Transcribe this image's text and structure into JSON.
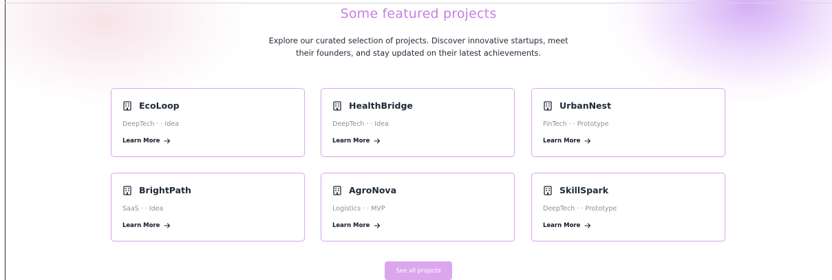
{
  "section": {
    "title": "Some featured projects",
    "intro_line1": "Explore our curated selection of projects. Discover innovative startups, meet",
    "intro_line2": "their founders, and stay updated on their latest achievements."
  },
  "projects": [
    {
      "name": "EcoLoop",
      "meta": "DeepTech · · Idea",
      "cta": "Learn More"
    },
    {
      "name": "HealthBridge",
      "meta": "DeepTech · · Idea",
      "cta": "Learn More"
    },
    {
      "name": "UrbanNest",
      "meta": "FinTech · · Prototype",
      "cta": "Learn More"
    },
    {
      "name": "BrightPath",
      "meta": "SaaS · · Idea",
      "cta": "Learn More"
    },
    {
      "name": "AgroNova",
      "meta": "Logistics · · MVP",
      "cta": "Learn More"
    },
    {
      "name": "SkillSpark",
      "meta": "DeepTech · · Prototype",
      "cta": "Learn More"
    }
  ],
  "see_all_label": "See all projects",
  "icons": {
    "card_icon": "building-icon",
    "cta_icon": "arrow-right-icon"
  },
  "colors": {
    "accent": "#c77de8",
    "card_border": "#d9a8ee",
    "button_bg": "#dca6ef",
    "text_primary": "#1f2937",
    "text_muted": "#8a8f98"
  }
}
